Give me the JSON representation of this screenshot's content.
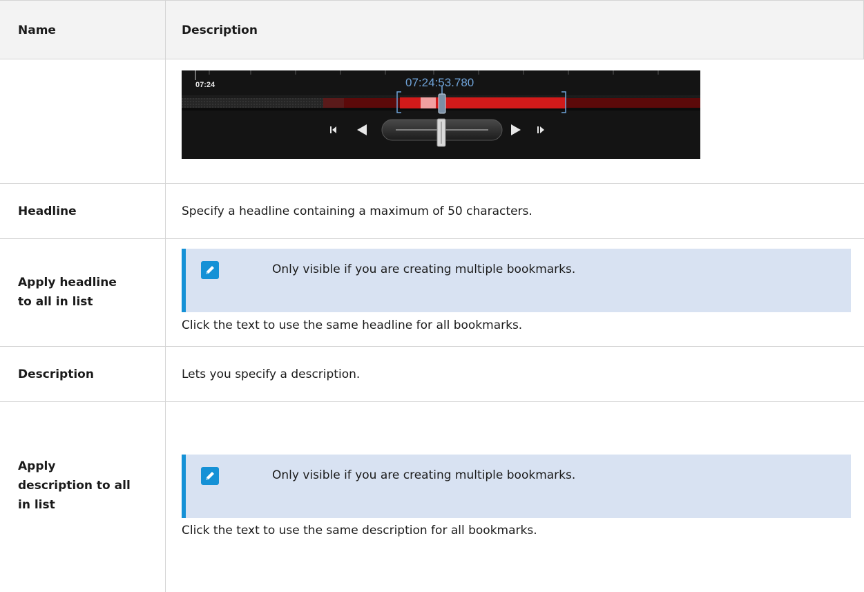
{
  "header": {
    "name": "Name",
    "description": "Description"
  },
  "timeline": {
    "start_label": "07:24",
    "current_time": "07:24:53.780"
  },
  "rows": {
    "headline": {
      "name": "Headline",
      "description": "Specify a headline containing a maximum of 50 characters."
    },
    "apply_headline": {
      "name_line1": "Apply headline",
      "name_line2": "to all in list",
      "note": "Only visible if you are creating multiple bookmarks.",
      "description": "Click the text to use the same headline for all bookmarks."
    },
    "description": {
      "name": "Description",
      "description": "Lets you specify a description."
    },
    "apply_description": {
      "name_line1": "Apply",
      "name_line2": "description to all",
      "name_line3": "in list",
      "note": "Only visible if you are creating multiple bookmarks.",
      "description": "Click the text to use the same description for all bookmarks."
    }
  },
  "icons": {
    "note": "pencil-icon"
  },
  "colors": {
    "accent": "#1591d6",
    "note_bg": "#d8e2f2",
    "timeline_red": "#d21a1a"
  }
}
